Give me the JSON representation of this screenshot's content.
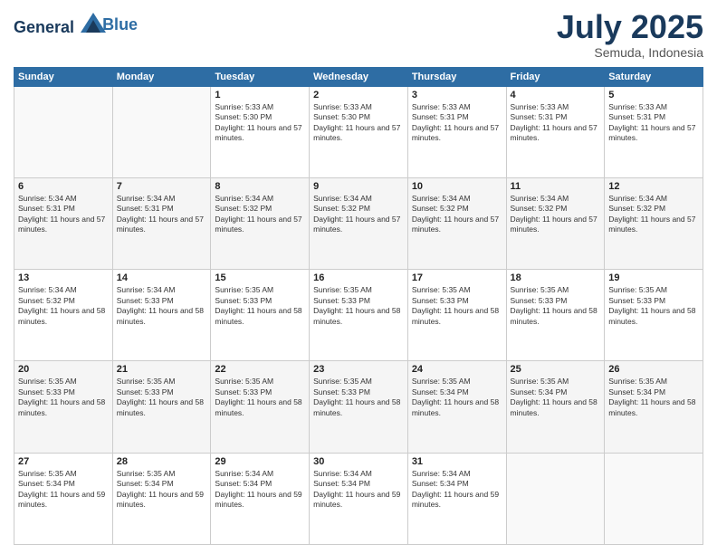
{
  "header": {
    "logo_line1": "General",
    "logo_line2": "Blue",
    "month": "July 2025",
    "location": "Semuda, Indonesia"
  },
  "weekdays": [
    "Sunday",
    "Monday",
    "Tuesday",
    "Wednesday",
    "Thursday",
    "Friday",
    "Saturday"
  ],
  "weeks": [
    [
      {
        "day": "",
        "sunrise": "",
        "sunset": "",
        "daylight": ""
      },
      {
        "day": "",
        "sunrise": "",
        "sunset": "",
        "daylight": ""
      },
      {
        "day": "1",
        "sunrise": "Sunrise: 5:33 AM",
        "sunset": "Sunset: 5:30 PM",
        "daylight": "Daylight: 11 hours and 57 minutes."
      },
      {
        "day": "2",
        "sunrise": "Sunrise: 5:33 AM",
        "sunset": "Sunset: 5:30 PM",
        "daylight": "Daylight: 11 hours and 57 minutes."
      },
      {
        "day": "3",
        "sunrise": "Sunrise: 5:33 AM",
        "sunset": "Sunset: 5:31 PM",
        "daylight": "Daylight: 11 hours and 57 minutes."
      },
      {
        "day": "4",
        "sunrise": "Sunrise: 5:33 AM",
        "sunset": "Sunset: 5:31 PM",
        "daylight": "Daylight: 11 hours and 57 minutes."
      },
      {
        "day": "5",
        "sunrise": "Sunrise: 5:33 AM",
        "sunset": "Sunset: 5:31 PM",
        "daylight": "Daylight: 11 hours and 57 minutes."
      }
    ],
    [
      {
        "day": "6",
        "sunrise": "Sunrise: 5:34 AM",
        "sunset": "Sunset: 5:31 PM",
        "daylight": "Daylight: 11 hours and 57 minutes."
      },
      {
        "day": "7",
        "sunrise": "Sunrise: 5:34 AM",
        "sunset": "Sunset: 5:31 PM",
        "daylight": "Daylight: 11 hours and 57 minutes."
      },
      {
        "day": "8",
        "sunrise": "Sunrise: 5:34 AM",
        "sunset": "Sunset: 5:32 PM",
        "daylight": "Daylight: 11 hours and 57 minutes."
      },
      {
        "day": "9",
        "sunrise": "Sunrise: 5:34 AM",
        "sunset": "Sunset: 5:32 PM",
        "daylight": "Daylight: 11 hours and 57 minutes."
      },
      {
        "day": "10",
        "sunrise": "Sunrise: 5:34 AM",
        "sunset": "Sunset: 5:32 PM",
        "daylight": "Daylight: 11 hours and 57 minutes."
      },
      {
        "day": "11",
        "sunrise": "Sunrise: 5:34 AM",
        "sunset": "Sunset: 5:32 PM",
        "daylight": "Daylight: 11 hours and 57 minutes."
      },
      {
        "day": "12",
        "sunrise": "Sunrise: 5:34 AM",
        "sunset": "Sunset: 5:32 PM",
        "daylight": "Daylight: 11 hours and 57 minutes."
      }
    ],
    [
      {
        "day": "13",
        "sunrise": "Sunrise: 5:34 AM",
        "sunset": "Sunset: 5:32 PM",
        "daylight": "Daylight: 11 hours and 58 minutes."
      },
      {
        "day": "14",
        "sunrise": "Sunrise: 5:34 AM",
        "sunset": "Sunset: 5:33 PM",
        "daylight": "Daylight: 11 hours and 58 minutes."
      },
      {
        "day": "15",
        "sunrise": "Sunrise: 5:35 AM",
        "sunset": "Sunset: 5:33 PM",
        "daylight": "Daylight: 11 hours and 58 minutes."
      },
      {
        "day": "16",
        "sunrise": "Sunrise: 5:35 AM",
        "sunset": "Sunset: 5:33 PM",
        "daylight": "Daylight: 11 hours and 58 minutes."
      },
      {
        "day": "17",
        "sunrise": "Sunrise: 5:35 AM",
        "sunset": "Sunset: 5:33 PM",
        "daylight": "Daylight: 11 hours and 58 minutes."
      },
      {
        "day": "18",
        "sunrise": "Sunrise: 5:35 AM",
        "sunset": "Sunset: 5:33 PM",
        "daylight": "Daylight: 11 hours and 58 minutes."
      },
      {
        "day": "19",
        "sunrise": "Sunrise: 5:35 AM",
        "sunset": "Sunset: 5:33 PM",
        "daylight": "Daylight: 11 hours and 58 minutes."
      }
    ],
    [
      {
        "day": "20",
        "sunrise": "Sunrise: 5:35 AM",
        "sunset": "Sunset: 5:33 PM",
        "daylight": "Daylight: 11 hours and 58 minutes."
      },
      {
        "day": "21",
        "sunrise": "Sunrise: 5:35 AM",
        "sunset": "Sunset: 5:33 PM",
        "daylight": "Daylight: 11 hours and 58 minutes."
      },
      {
        "day": "22",
        "sunrise": "Sunrise: 5:35 AM",
        "sunset": "Sunset: 5:33 PM",
        "daylight": "Daylight: 11 hours and 58 minutes."
      },
      {
        "day": "23",
        "sunrise": "Sunrise: 5:35 AM",
        "sunset": "Sunset: 5:33 PM",
        "daylight": "Daylight: 11 hours and 58 minutes."
      },
      {
        "day": "24",
        "sunrise": "Sunrise: 5:35 AM",
        "sunset": "Sunset: 5:34 PM",
        "daylight": "Daylight: 11 hours and 58 minutes."
      },
      {
        "day": "25",
        "sunrise": "Sunrise: 5:35 AM",
        "sunset": "Sunset: 5:34 PM",
        "daylight": "Daylight: 11 hours and 58 minutes."
      },
      {
        "day": "26",
        "sunrise": "Sunrise: 5:35 AM",
        "sunset": "Sunset: 5:34 PM",
        "daylight": "Daylight: 11 hours and 58 minutes."
      }
    ],
    [
      {
        "day": "27",
        "sunrise": "Sunrise: 5:35 AM",
        "sunset": "Sunset: 5:34 PM",
        "daylight": "Daylight: 11 hours and 59 minutes."
      },
      {
        "day": "28",
        "sunrise": "Sunrise: 5:35 AM",
        "sunset": "Sunset: 5:34 PM",
        "daylight": "Daylight: 11 hours and 59 minutes."
      },
      {
        "day": "29",
        "sunrise": "Sunrise: 5:34 AM",
        "sunset": "Sunset: 5:34 PM",
        "daylight": "Daylight: 11 hours and 59 minutes."
      },
      {
        "day": "30",
        "sunrise": "Sunrise: 5:34 AM",
        "sunset": "Sunset: 5:34 PM",
        "daylight": "Daylight: 11 hours and 59 minutes."
      },
      {
        "day": "31",
        "sunrise": "Sunrise: 5:34 AM",
        "sunset": "Sunset: 5:34 PM",
        "daylight": "Daylight: 11 hours and 59 minutes."
      },
      {
        "day": "",
        "sunrise": "",
        "sunset": "",
        "daylight": ""
      },
      {
        "day": "",
        "sunrise": "",
        "sunset": "",
        "daylight": ""
      }
    ]
  ]
}
